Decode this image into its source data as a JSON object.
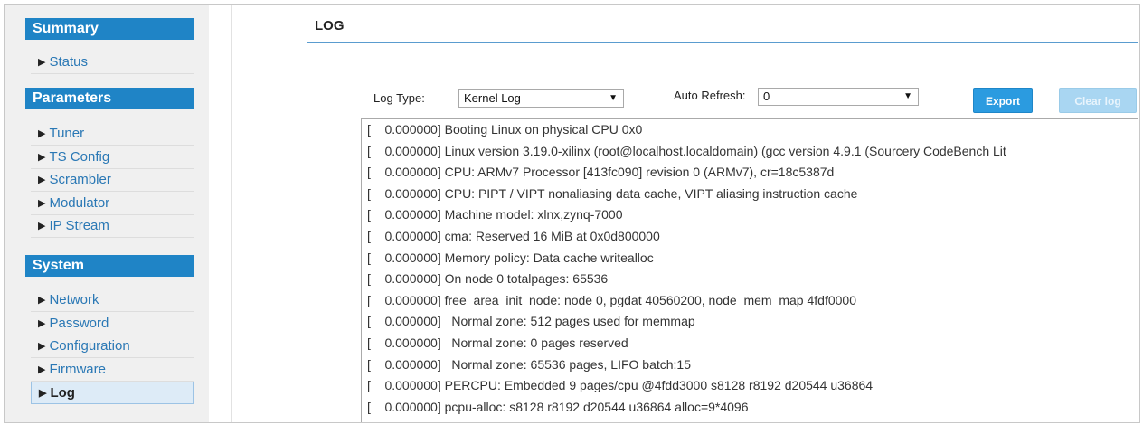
{
  "sidebar": {
    "sections": [
      {
        "title": "Summary",
        "items": [
          {
            "label": "Status"
          }
        ]
      },
      {
        "title": "Parameters",
        "items": [
          {
            "label": "Tuner"
          },
          {
            "label": "TS Config"
          },
          {
            "label": "Scrambler"
          },
          {
            "label": "Modulator"
          },
          {
            "label": "IP Stream"
          }
        ]
      },
      {
        "title": "System",
        "items": [
          {
            "label": "Network"
          },
          {
            "label": "Password"
          },
          {
            "label": "Configuration"
          },
          {
            "label": "Firmware"
          },
          {
            "label": "Log",
            "active": true
          }
        ]
      }
    ]
  },
  "page": {
    "title": "LOG"
  },
  "controls": {
    "log_type_label": "Log Type:",
    "log_type_value": "Kernel Log",
    "auto_refresh_label": "Auto Refresh:",
    "auto_refresh_value": "0",
    "export_label": "Export",
    "clear_label": "Clear log"
  },
  "log_lines": [
    "[    0.000000] Booting Linux on physical CPU 0x0",
    "[    0.000000] Linux version 3.19.0-xilinx (root@localhost.localdomain) (gcc version 4.9.1 (Sourcery CodeBench Lit",
    "[    0.000000] CPU: ARMv7 Processor [413fc090] revision 0 (ARMv7), cr=18c5387d",
    "[    0.000000] CPU: PIPT / VIPT nonaliasing data cache, VIPT aliasing instruction cache",
    "[    0.000000] Machine model: xlnx,zynq-7000",
    "[    0.000000] cma: Reserved 16 MiB at 0x0d800000",
    "[    0.000000] Memory policy: Data cache writealloc",
    "[    0.000000] On node 0 totalpages: 65536",
    "[    0.000000] free_area_init_node: node 0, pgdat 40560200, node_mem_map 4fdf0000",
    "[    0.000000]   Normal zone: 512 pages used for memmap",
    "[    0.000000]   Normal zone: 0 pages reserved",
    "[    0.000000]   Normal zone: 65536 pages, LIFO batch:15",
    "[    0.000000] PERCPU: Embedded 9 pages/cpu @4fdd3000 s8128 r8192 d20544 u36864",
    "[    0.000000] pcpu-alloc: s8128 r8192 d20544 u36864 alloc=9*4096"
  ]
}
